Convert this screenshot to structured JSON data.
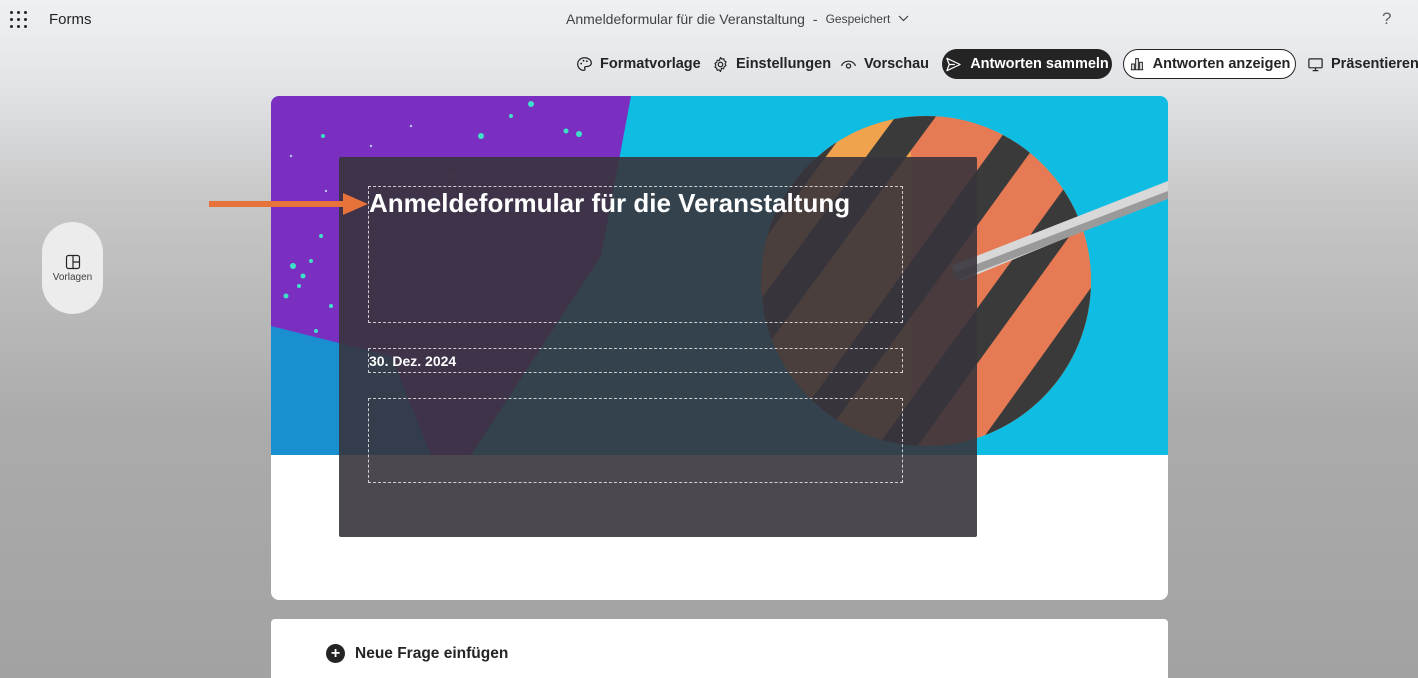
{
  "app": {
    "name": "Forms"
  },
  "document": {
    "title": "Anmeldeformular für die Veranstaltung",
    "separator": "-",
    "status": "Gespeichert"
  },
  "help": {
    "label": "?"
  },
  "toolbar": {
    "format_label": "Formatvorlage",
    "settings_label": "Einstellungen",
    "preview_label": "Vorschau",
    "collect_label": "Antworten sammeln",
    "view_label": "Antworten anzeigen",
    "present_label": "Präsentieren"
  },
  "sidebar": {
    "templates_label": "Vorlagen"
  },
  "form": {
    "title": "Anmeldeformular für die Veranstaltung",
    "date": "30. Dez. 2024",
    "description": ""
  },
  "question": {
    "add_label": "Neue Frage einfügen"
  },
  "colors": {
    "accent_dark": "#242424",
    "annotation_arrow": "#e8733a",
    "banner_purple": "#7b2fc0",
    "banner_cyan": "#0bc4e6",
    "banner_orange": "#f4a94a"
  }
}
